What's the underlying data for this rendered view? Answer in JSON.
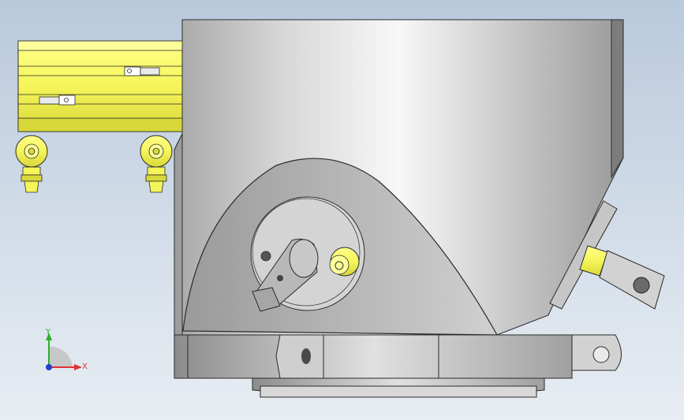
{
  "viewport": {
    "background_top": "#b9c9dc",
    "background_bottom": "#e8edf3"
  },
  "model": {
    "colors": {
      "body_light": "#f2f2f2",
      "body_mid": "#c8c8c8",
      "body_dark": "#8a8a8a",
      "yellow": "#f5f55a",
      "yellow_dark": "#c9c92a",
      "outline": "#2a2a2a"
    }
  },
  "triad": {
    "x_label": "X",
    "y_label": "Y",
    "x_color": "#e03030",
    "y_color": "#2bb02b",
    "z_color": "#2040d0"
  }
}
